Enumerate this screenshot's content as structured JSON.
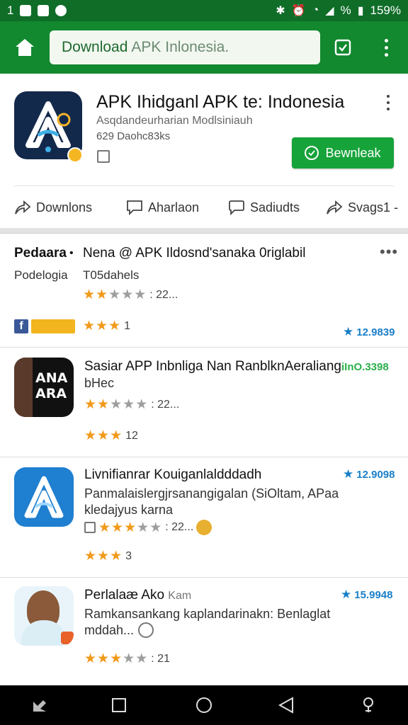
{
  "status_bar": {
    "left_text": "1",
    "battery": "159%",
    "percent_sign": "%"
  },
  "toolbar": {
    "url_text": "Download",
    "url_hint": "APK Inlonesia."
  },
  "app_header": {
    "title": "APK Ihidganl APK te: Indonesia",
    "subtitle": "Asqdandeurharian Modlsiniauh",
    "meta": "629 Daohc83ks",
    "download_button": "Bewnleak",
    "actions": [
      "Downlons",
      "Aharlaon",
      "Sadiudts",
      "Svags1 -"
    ]
  },
  "items": [
    {
      "left_label": "Pedaara",
      "title": "Nena @ APK Ildosnd'sanaka 0riglabil",
      "secondary_left": "Podelogia",
      "desc": "T05dahels",
      "rating_text": ": 22...",
      "rating2_text": "1",
      "price": "12.9839",
      "rating": 2,
      "rating_row2": 3
    },
    {
      "title": "Sasiar APP Inbnliga Nan RanblknAeraliang",
      "title_suffix": "iInO.3398",
      "desc": "bHec",
      "rating_text": ": 22...",
      "rating2_text": "12",
      "thumb_text": "ANA ARA",
      "rating": 2,
      "rating_row2": 3
    },
    {
      "title": "Livnifianrar Kouiganlaldddadh",
      "desc1": "Panmalaislergjrsanangigalan (SiOltam, APaa",
      "desc2": "kledajyus karna",
      "rating_text": ": 22...",
      "rating2_text": "3",
      "price": "12.9098",
      "rating": 3,
      "rating_row2": 3
    },
    {
      "title": "Perlalaæ Ako",
      "title_hint": "Kam",
      "desc1": "Ramkansankang kaplandarinakn: Benlaglat",
      "desc2": "mddah...",
      "rating_text": ": 21",
      "price": "15.9948",
      "rating": 3
    }
  ],
  "colors": {
    "toolbar_green": "#12882f",
    "status_green": "#0f6d28",
    "button_green": "#16a33a",
    "star_orange": "#f19a1b",
    "price_blue": "#1a7fc8"
  }
}
